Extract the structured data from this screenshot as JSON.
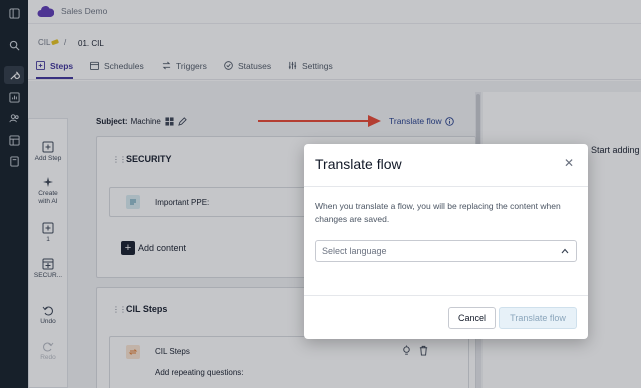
{
  "app": {
    "title": "Sales Demo"
  },
  "breadcrumb": {
    "parent": "CIL",
    "separator": "/",
    "current": "01. CIL"
  },
  "tabs": [
    {
      "label": "Steps",
      "icon": "steps-icon",
      "active": true
    },
    {
      "label": "Schedules",
      "icon": "calendar-icon",
      "active": false
    },
    {
      "label": "Triggers",
      "icon": "swap-icon",
      "active": false
    },
    {
      "label": "Statuses",
      "icon": "check-circle-icon",
      "active": false
    },
    {
      "label": "Settings",
      "icon": "sliders-icon",
      "active": false
    }
  ],
  "nav_icons": [
    "panel-toggle-icon",
    "search-icon",
    "tools-icon",
    "chart-icon",
    "users-icon",
    "table-icon",
    "book-icon"
  ],
  "tools": {
    "add_step": "Add Step",
    "create_ai_line1": "Create",
    "create_ai_line2": "with AI",
    "step_1": "1",
    "step_security": "SECUR...",
    "undo": "Undo",
    "redo": "Redo"
  },
  "subject": {
    "label": "Subject:",
    "value": "Machine"
  },
  "translate_link": "Translate flow",
  "sections": [
    {
      "title": "SECURITY",
      "items": [
        {
          "label": "Important PPE:"
        }
      ],
      "add_content": "Add content"
    },
    {
      "title": "CIL Steps",
      "items": [
        {
          "label": "CIL Steps",
          "sub": "Add repeating questions:"
        }
      ]
    }
  ],
  "right_panel": {
    "hint": "Start adding"
  },
  "modal": {
    "title": "Translate flow",
    "description": "When you translate a flow, you will be replacing the content when changes are saved.",
    "select_placeholder": "Select language",
    "cancel_label": "Cancel",
    "confirm_label": "Translate flow"
  },
  "colors": {
    "accent": "#3b2f99",
    "nav_bg": "#0f1923",
    "arrow": "#e8432e",
    "link": "#1f3a8a",
    "confirm_disabled_bg": "#e7f1f8"
  }
}
